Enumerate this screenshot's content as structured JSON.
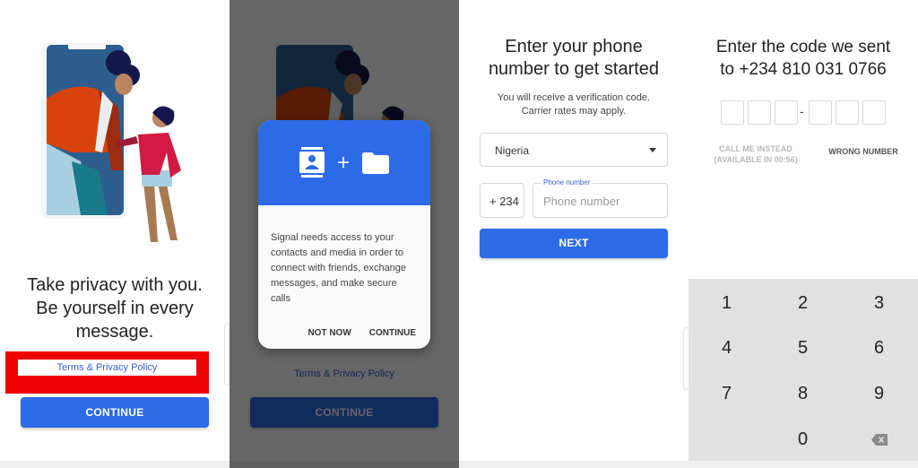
{
  "colors": {
    "accent": "#2c6be5",
    "link": "#3a62c9",
    "highlight_frame": "#ee0000",
    "keypad_bg": "#e1e1e1"
  },
  "welcome": {
    "illustration": "person-emerging-from-phone-illustration",
    "headline_lines": [
      "Take privacy with you.",
      "Be yourself in every",
      "message."
    ],
    "terms_link": "Terms & Privacy Policy",
    "continue_button": "CONTINUE"
  },
  "permission_dialog": {
    "icons": [
      "contacts-icon",
      "plus-icon",
      "folder-icon"
    ],
    "plus_symbol": "+",
    "message": "Signal needs access to your contacts and media in order to connect with friends, exchange messages, and make secure calls",
    "not_now_button": "NOT NOW",
    "continue_button": "CONTINUE",
    "background": {
      "terms_link": "Terms & Privacy Policy",
      "continue_button": "CONTINUE"
    }
  },
  "phone_entry": {
    "title_lines": [
      "Enter your phone",
      "number to get started"
    ],
    "subtitle_lines": [
      "You will receive a verification code.",
      "Carrier rates may apply."
    ],
    "country_select": {
      "value": "Nigeria"
    },
    "country_code": "+ 234",
    "phone_input": {
      "label": "Phone number",
      "placeholder": "Phone number",
      "value": ""
    },
    "next_button": "NEXT"
  },
  "verify_code": {
    "title_lines": [
      "Enter the code we sent",
      "to +234 810 031 0766"
    ],
    "code_digits": [
      "",
      "",
      "",
      "",
      "",
      ""
    ],
    "separator": "-",
    "call_me_instead_lines": [
      "CALL ME INSTEAD",
      "(AVAILABLE IN 00:56)"
    ],
    "wrong_number_button": "WRONG NUMBER",
    "keypad": {
      "keys": [
        "1",
        "2",
        "3",
        "4",
        "5",
        "6",
        "7",
        "8",
        "9",
        "",
        "0",
        "backspace"
      ]
    }
  }
}
